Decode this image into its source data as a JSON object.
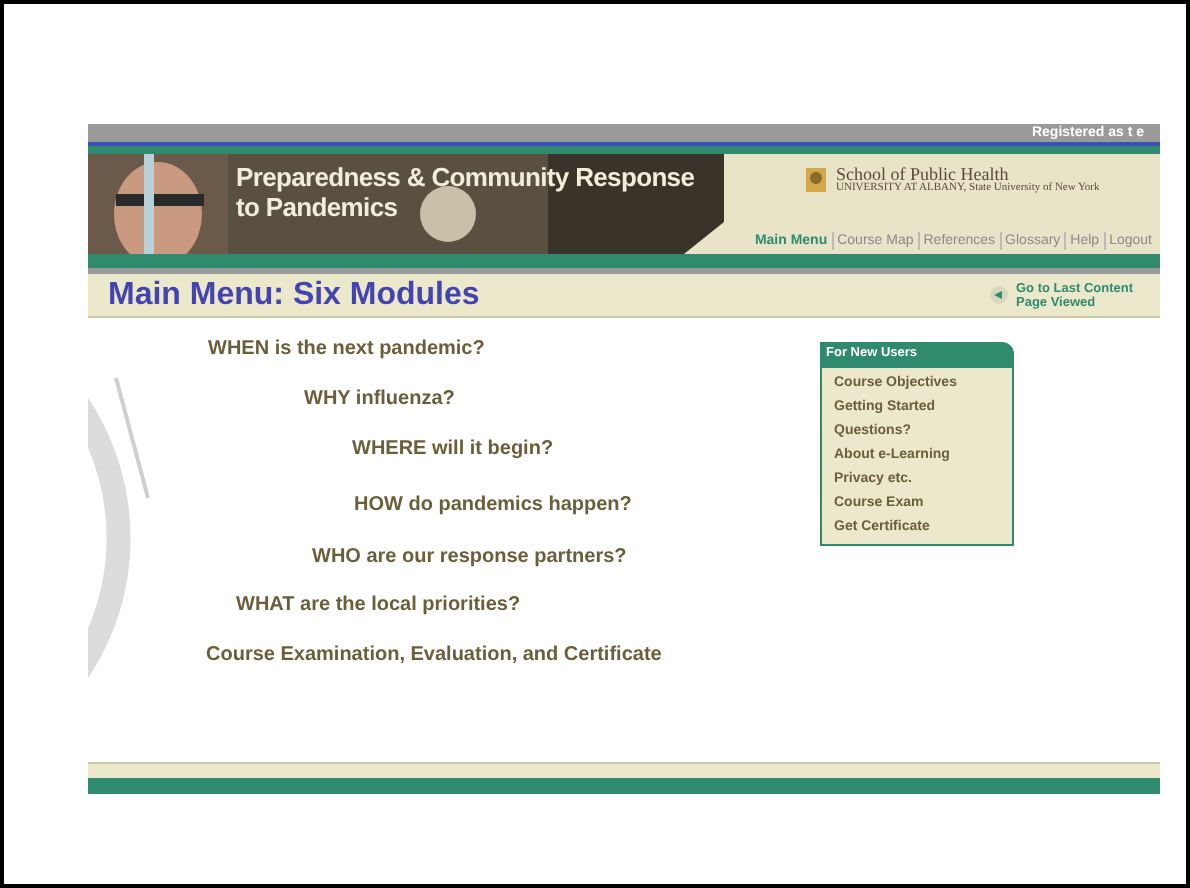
{
  "header": {
    "registered": "Registered as t e",
    "title_lines": [
      "Preparedness & Community Response",
      "to Pandemics"
    ],
    "school": {
      "name": "School of Public Health",
      "subtitle": "UNIVERSITY AT ALBANY, State University of New York"
    }
  },
  "nav": [
    {
      "label": "Main Menu",
      "selected": true
    },
    {
      "label": "Course Map",
      "selected": false
    },
    {
      "label": "References",
      "selected": false
    },
    {
      "label": "Glossary",
      "selected": false
    },
    {
      "label": "Help",
      "selected": false
    },
    {
      "label": "Logout",
      "selected": false
    }
  ],
  "page_title": "Main Menu: Six Modules",
  "last_content_link": "Go to Last Content Page Viewed",
  "modules": [
    "WHEN is the next pandemic?",
    "WHY influenza?",
    "WHERE will it begin?",
    "HOW do pandemics happen?",
    "WHO are our response partners?",
    "WHAT are the local priorities?",
    "Course Examination, Evaluation, and Certificate"
  ],
  "new_users": {
    "title": "For New Users",
    "links": [
      "Course Objectives",
      "Getting Started",
      "Questions?",
      "About e-Learning",
      "Privacy etc.",
      "Course Exam",
      "Get Certificate"
    ]
  }
}
